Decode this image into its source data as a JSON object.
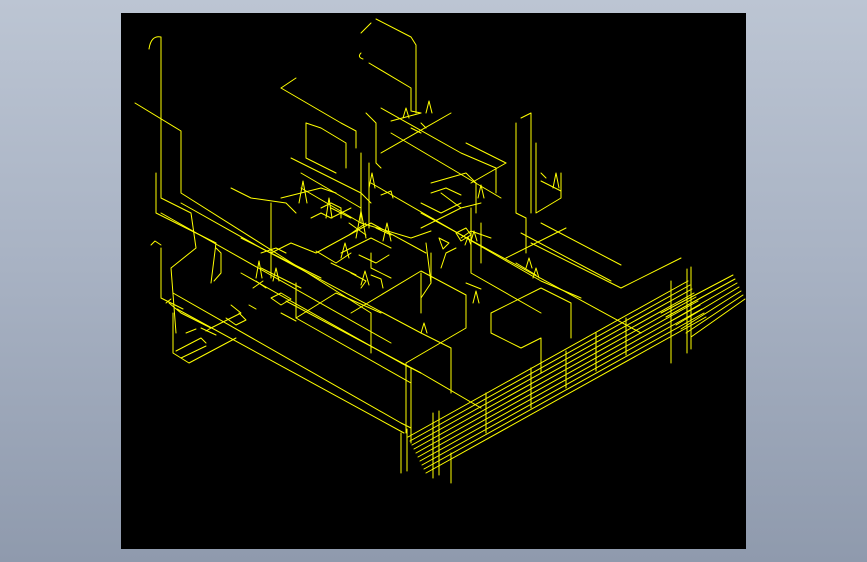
{
  "viewer": {
    "background": "#000000",
    "line_color": "#ffff00",
    "frame_color": "#b4bdcc"
  },
  "drawing": {
    "kind": "isometric piping / wiring CAD drawing",
    "has_text": false,
    "symbol_names": [
      "valve-symbol",
      "flow-arrow-symbol",
      "pipe-bend"
    ]
  }
}
